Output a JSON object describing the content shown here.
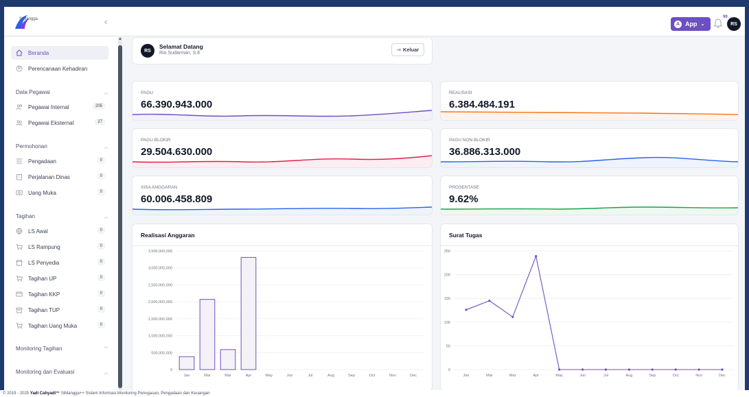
{
  "brand": {
    "name": "SiMangga"
  },
  "header": {
    "app_label": "App",
    "app_icon": "A",
    "notif_count": "99",
    "avatar": "RS"
  },
  "welcome": {
    "avatar": "RS",
    "title": "Selamat Datang",
    "name": "Rio Sudarman, S.E",
    "logout": "Keluar"
  },
  "sidebar": {
    "top": [
      {
        "label": "Beranda",
        "icon": "home-icon",
        "active": true
      },
      {
        "label": "Perencanaan Kehadiran",
        "icon": "person-circle-icon"
      }
    ],
    "sections": [
      {
        "title": "Data Pegawai",
        "items": [
          {
            "label": "Pegawai Internal",
            "badge": "205",
            "icon": "users-icon"
          },
          {
            "label": "Pegawai Eksternal",
            "badge": "27",
            "icon": "users-outline-icon"
          }
        ]
      },
      {
        "title": "Permohonan",
        "items": [
          {
            "label": "Pengadaan",
            "badge": "0",
            "icon": "list-icon"
          },
          {
            "label": "Perjalanan Dinas",
            "badge": "0",
            "icon": "building-icon"
          },
          {
            "label": "Uang Muka",
            "badge": "0",
            "icon": "money-icon"
          }
        ]
      },
      {
        "title": "Tagihan",
        "items": [
          {
            "label": "LS Awal",
            "badge": "0",
            "icon": "globe-icon"
          },
          {
            "label": "LS Rampung",
            "badge": "0",
            "icon": "cart-icon"
          },
          {
            "label": "LS Penyedia",
            "badge": "0",
            "icon": "store-icon"
          },
          {
            "label": "Tagihan UP",
            "badge": "0",
            "icon": "cart-icon"
          },
          {
            "label": "Tagihan KKP",
            "badge": "0",
            "icon": "card-icon"
          },
          {
            "label": "Tagihan TUP",
            "badge": "0",
            "icon": "box-icon"
          },
          {
            "label": "Tagihan Uang Muka",
            "badge": "0",
            "icon": "cart-icon"
          }
        ]
      }
    ],
    "bottom": [
      {
        "title": "Monitoring Tagihan"
      },
      {
        "title": "Monitoring dan Evaluasi"
      }
    ]
  },
  "stats": [
    {
      "label": "PAGU",
      "value": "66.390.943.000",
      "color": "#6d4fc2"
    },
    {
      "label": "REALISASI",
      "value": "6.384.484.191",
      "color": "#f97316"
    },
    {
      "label": "PAGU BLOKIR",
      "value": "29.504.630.000",
      "color": "#e11d48"
    },
    {
      "label": "PAGU NON BLOKIR",
      "value": "36.886.313.000",
      "color": "#2563eb"
    },
    {
      "label": "SISA ANGGARAN",
      "value": "60.006.458.809",
      "color": "#2563eb"
    },
    {
      "label": "PROSENTASE",
      "value": "9.62%",
      "color": "#16a34a"
    }
  ],
  "chart_data": [
    {
      "type": "bar",
      "title": "Realisasi Anggaran",
      "categories": [
        "Jan",
        "Mar",
        "Mar",
        "Apr",
        "May",
        "Jun",
        "Jul",
        "Aug",
        "Sep",
        "Oct",
        "Nov",
        "Dec"
      ],
      "values": [
        380000000,
        2070000000,
        590000000,
        3310000000,
        0,
        0,
        0,
        0,
        0,
        0,
        0,
        0
      ],
      "ylim": [
        0,
        3500000000
      ],
      "yticks": [
        "0",
        "500,000,000",
        "1,000,000,000",
        "1,500,000,000",
        "2,000,000,000",
        "2,500,000,000",
        "3,000,000,000",
        "3,500,000,000"
      ],
      "color": "#6d4fc2"
    },
    {
      "type": "line",
      "title": "Surat Tugas",
      "categories": [
        "Jan",
        "Mar",
        "Mar",
        "Apr",
        "May",
        "Jun",
        "Jul",
        "Aug",
        "Sep",
        "Oct",
        "Nov",
        "Dec"
      ],
      "values": [
        126,
        145,
        111,
        239,
        0,
        0,
        0,
        0,
        0,
        0,
        0,
        0
      ],
      "ylim": [
        0,
        250
      ],
      "yticks": [
        "0",
        "50",
        "100",
        "150",
        "200",
        "250"
      ],
      "color": "#6d4fc2"
    }
  ],
  "footer": {
    "prefix": "© 2019 - 2025 ",
    "author": "Yadi Cahyadi™",
    "suffix": " SiMangga++ Sistem Informasi Monitoring Penugasan, Pengadaan dan Keuangan"
  }
}
